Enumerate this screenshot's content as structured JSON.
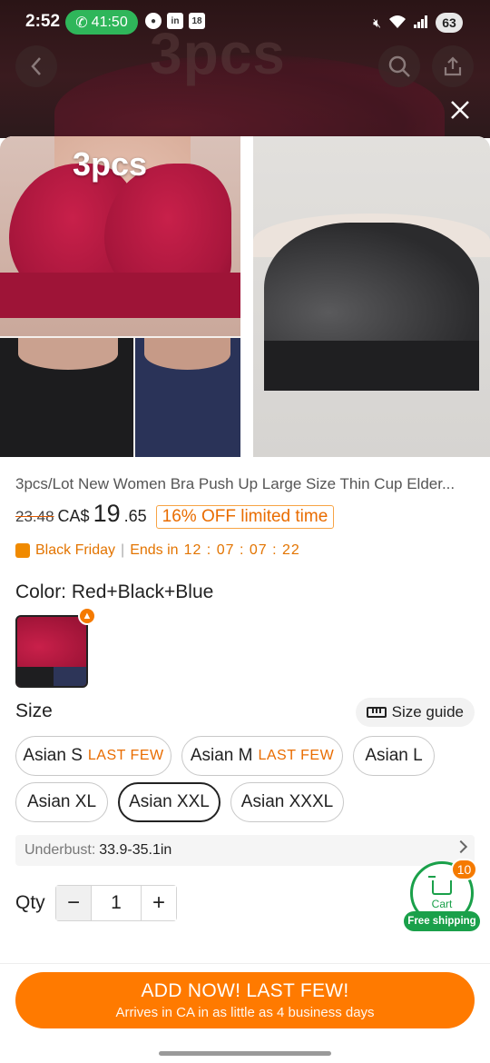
{
  "status_bar": {
    "time": "2:52",
    "call_timer": "41:50",
    "notif_badge": "18",
    "battery": "63"
  },
  "background": {
    "overlay_text": "3pcs"
  },
  "gallery": {
    "main_image_label": "3pcs"
  },
  "product": {
    "title": "3pcs/Lot New Women Bra Push Up Large Size Thin Cup Elder...",
    "old_price": "23.48",
    "currency": "CA$",
    "price_whole": "19",
    "price_cents": ".65",
    "discount_badge": "16% OFF limited time"
  },
  "promo": {
    "event": "Black Friday",
    "ends_label": "Ends in",
    "timer": "12 : 07 : 07 : 22"
  },
  "color": {
    "label": "Color:",
    "selected": "Red+Black+Blue"
  },
  "size": {
    "label": "Size",
    "guide_label": "Size guide",
    "options": [
      {
        "label": "Asian S",
        "tag": "LAST FEW"
      },
      {
        "label": "Asian M",
        "tag": "LAST FEW"
      },
      {
        "label": "Asian L",
        "tag": ""
      },
      {
        "label": "Asian XL",
        "tag": ""
      },
      {
        "label": "Asian XXL",
        "tag": ""
      },
      {
        "label": "Asian XXXL",
        "tag": ""
      }
    ],
    "selected": "Asian XXL"
  },
  "underbust": {
    "label": "Underbust:",
    "value": "33.9-35.1in"
  },
  "quantity": {
    "label": "Qty",
    "value": "1",
    "minus": "−",
    "plus": "+"
  },
  "cart": {
    "label": "Cart",
    "count": "10",
    "free_shipping": "Free shipping"
  },
  "cta": {
    "main": "ADD NOW! LAST FEW!",
    "sub": "Arrives in CA in as little as 4 business days"
  },
  "colors": {
    "accent": "#ff7a00",
    "green": "#1aa04a",
    "promo_orange": "#e37400"
  }
}
